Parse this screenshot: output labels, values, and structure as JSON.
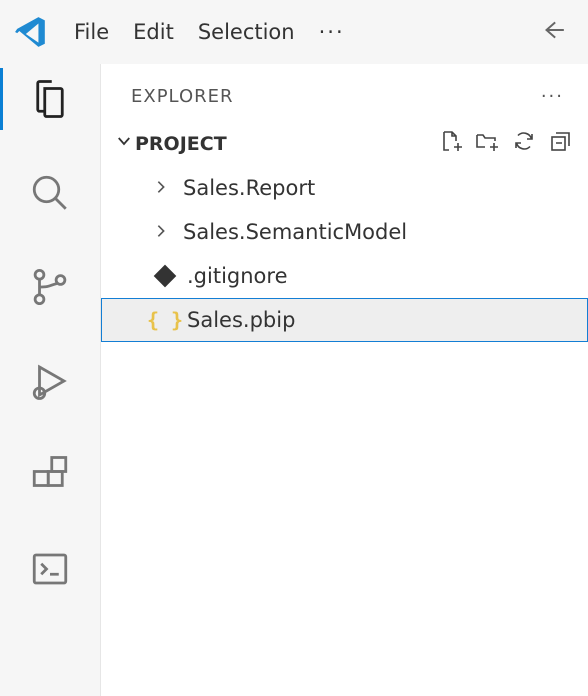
{
  "menu": {
    "file": "File",
    "edit": "Edit",
    "selection": "Selection"
  },
  "explorer": {
    "title": "EXPLORER"
  },
  "project": {
    "title": "PROJECT"
  },
  "tree": {
    "folder1": "Sales.Report",
    "folder2": "Sales.SemanticModel",
    "file1": ".gitignore",
    "file2": "Sales.pbip"
  }
}
